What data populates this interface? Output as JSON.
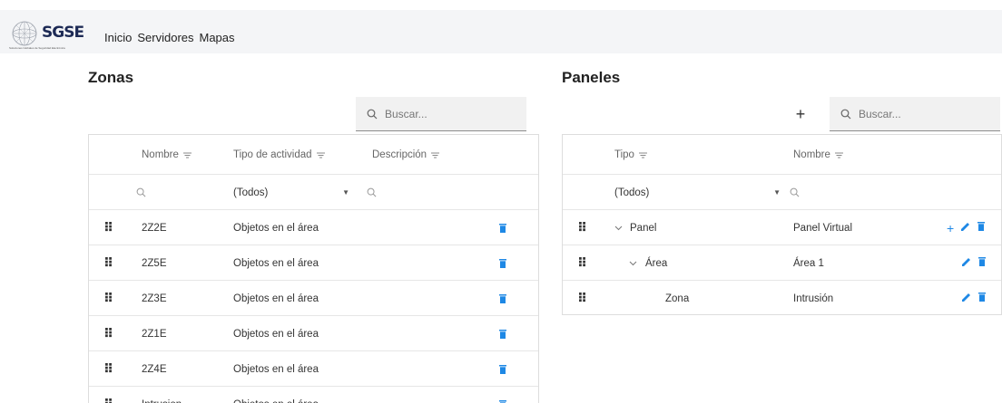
{
  "app": {
    "brand": "SGSE",
    "brand_sub": "Soluciones Globales de Seguridad Electrónica",
    "accent": "#1e88e5"
  },
  "nav": {
    "items": [
      "Inicio",
      "Servidores",
      "Mapas"
    ]
  },
  "zonas": {
    "title": "Zonas",
    "search_placeholder": "Buscar...",
    "columns": [
      "Nombre",
      "Tipo de actividad",
      "Descripción"
    ],
    "filter_selected": "(Todos)",
    "rows": [
      {
        "nombre": "2Z2E",
        "tipo": "Objetos en el área"
      },
      {
        "nombre": "2Z5E",
        "tipo": "Objetos en el área"
      },
      {
        "nombre": "2Z3E",
        "tipo": "Objetos en el área"
      },
      {
        "nombre": "2Z1E",
        "tipo": "Objetos en el área"
      },
      {
        "nombre": "2Z4E",
        "tipo": "Objetos en el área"
      },
      {
        "nombre": "Intrusion",
        "tipo": "Objetos en el área"
      }
    ]
  },
  "paneles": {
    "title": "Paneles",
    "add_label": "+",
    "search_placeholder": "Buscar...",
    "columns": [
      "Tipo",
      "Nombre"
    ],
    "filter_selected": "(Todos)",
    "rows": [
      {
        "tipo": "Panel",
        "nombre": "Panel Virtual",
        "expanded": true
      },
      {
        "tipo": "Área",
        "nombre": "Área 1",
        "expanded": true
      },
      {
        "tipo": "Zona",
        "nombre": "Intrusión"
      }
    ]
  }
}
